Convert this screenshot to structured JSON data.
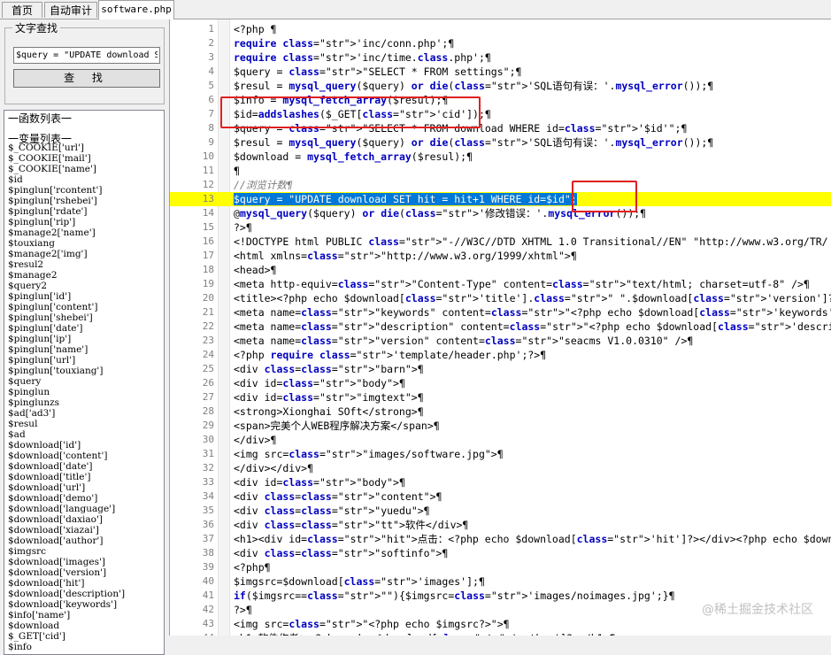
{
  "tabs": [
    {
      "label": "首页"
    },
    {
      "label": "自动审计"
    },
    {
      "label": "software.php"
    }
  ],
  "search": {
    "group_title": "文字查找",
    "input_value": "$query = \"UPDATE download SE",
    "button_label": "查 找"
  },
  "lists": {
    "functions_header": "一函数列表一",
    "variables_header": "一变量列表一",
    "variables": [
      "$_COOKIE['url']",
      "$_COOKIE['mail']",
      "$_COOKIE['name']",
      "$id",
      "$pinglun['rcontent']",
      "$pinglun['rshebei']",
      "$pinglun['rdate']",
      "$pinglun['rip']",
      "$manage2['name']",
      "$touxiang",
      "$manage2['img']",
      "$resul2",
      "$manage2",
      "$query2",
      "$pinglun['id']",
      "$pinglun['content']",
      "$pinglun['shebei']",
      "$pinglun['date']",
      "$pinglun['ip']",
      "$pinglun['name']",
      "$pinglun['url']",
      "$pinglun['touxiang']",
      "$query",
      "$pinglun",
      "$pinglunzs",
      "$ad['ad3']",
      "$resul",
      "$ad",
      "$download['id']",
      "$download['content']",
      "$download['date']",
      "$download['title']",
      "$download['url']",
      "$download['demo']",
      "$download['language']",
      "$download['daxiao']",
      "$download['xiazai']",
      "$download['author']",
      "$imgsrc",
      "$download['images']",
      "$download['version']",
      "$download['hit']",
      "$download['description']",
      "$download['keywords']",
      "$info['name']",
      "$download",
      "$_GET['cid']",
      "$info"
    ]
  },
  "code_lines": [
    {
      "n": "1",
      "t": "<?php ¶"
    },
    {
      "n": "2",
      "t": "require 'inc/conn.php';¶"
    },
    {
      "n": "3",
      "t": "require 'inc/time.class.php';¶"
    },
    {
      "n": "4",
      "t": "$query = \"SELECT * FROM settings\";¶"
    },
    {
      "n": "5",
      "t": "$resul = mysql_query($query) or die('SQL语句有误：'.mysql_error());¶"
    },
    {
      "n": "6",
      "t": "$info = mysql_fetch_array($resul);¶"
    },
    {
      "n": "7",
      "t": "$id=addslashes($_GET['cid']);¶"
    },
    {
      "n": "8",
      "t": "$query = \"SELECT * FROM download WHERE id='$id'\";¶"
    },
    {
      "n": "9",
      "t": "$resul = mysql_query($query) or die('SQL语句有误：'.mysql_error());¶"
    },
    {
      "n": "10",
      "t": "$download = mysql_fetch_array($resul);¶"
    },
    {
      "n": "11",
      "t": "¶"
    },
    {
      "n": "12",
      "t": "//浏览计数¶"
    },
    {
      "n": "13",
      "t": "$query = \"UPDATE download SET hit = hit+1 WHERE id=$id\";"
    },
    {
      "n": "14",
      "t": "@mysql_query($query) or die('修改错误：'.mysql_error());¶"
    },
    {
      "n": "15",
      "t": "?>¶"
    },
    {
      "n": "16",
      "t": "<!DOCTYPE html PUBLIC \"-//W3C//DTD XHTML 1.0 Transitional//EN\" \"http://www.w3.org/TR/"
    },
    {
      "n": "17",
      "t": "<html xmlns=\"http://www.w3.org/1999/xhtml\">¶"
    },
    {
      "n": "18",
      "t": "<head>¶"
    },
    {
      "n": "19",
      "t": "<meta http-equiv=\"Content-Type\" content=\"text/html; charset=utf-8\" />¶"
    },
    {
      "n": "20",
      "t": "<title><?php echo $download['title'].\" \".$download['version']?> - <?php echo $info['n"
    },
    {
      "n": "21",
      "t": "<meta name=\"keywords\" content=\"<?php echo $download['keywords']?>\" />¶"
    },
    {
      "n": "22",
      "t": "<meta name=\"description\" content=\"<?php echo $download['description']?>\" />¶"
    },
    {
      "n": "23",
      "t": "<meta name=\"version\" content=\"seacms V1.0.0310\" />¶"
    },
    {
      "n": "24",
      "t": "<?php require 'template/header.php';?>¶"
    },
    {
      "n": "25",
      "t": "<div class=\"barn\">¶"
    },
    {
      "n": "26",
      "t": "<div id=\"body\">¶"
    },
    {
      "n": "27",
      "t": "<div id=\"imgtext\">¶"
    },
    {
      "n": "28",
      "t": "<strong>Xionghai SOft</strong>¶"
    },
    {
      "n": "29",
      "t": "<span>完美个人WEB程序解决方案</span>¶"
    },
    {
      "n": "30",
      "t": "</div>¶"
    },
    {
      "n": "31",
      "t": "<img src=\"images/software.jpg\">¶"
    },
    {
      "n": "32",
      "t": "</div></div>¶"
    },
    {
      "n": "33",
      "t": "<div id=\"body\">¶"
    },
    {
      "n": "34",
      "t": "<div class=\"content\">¶"
    },
    {
      "n": "35",
      "t": "<div class=\"yuedu\">¶"
    },
    {
      "n": "36",
      "t": "<div class=\"tt\">软件</div>¶"
    },
    {
      "n": "37",
      "t": "<h1><div id=\"hit\">点击：<?php echo $download['hit']?></div><?php echo $download['titl"
    },
    {
      "n": "38",
      "t": "<div class=\"softinfo\">¶"
    },
    {
      "n": "39",
      "t": "<?php¶"
    },
    {
      "n": "40",
      "t": "$imgsrc=$download['images'];¶"
    },
    {
      "n": "41",
      "t": "if($imgsrc==\"\"){$imgsrc='images/noimages.jpg';}¶"
    },
    {
      "n": "42",
      "t": "?>¶"
    },
    {
      "n": "43",
      "t": "<img src=\"<?php echo $imgsrc?>\">¶"
    },
    {
      "n": "44",
      "t": "<h1>软件作者：<?php echo $download['author']?></h1>¶"
    }
  ],
  "annotation": {
    "note_13": "修改错误：'.mysql_error());"
  },
  "watermark": "@稀土掘金技术社区",
  "colors": {
    "highlight": "#ffff00",
    "selection": "#0078d7",
    "annotation_box": "#e02020",
    "keyword": "#0000c0",
    "string": "#d80080"
  }
}
